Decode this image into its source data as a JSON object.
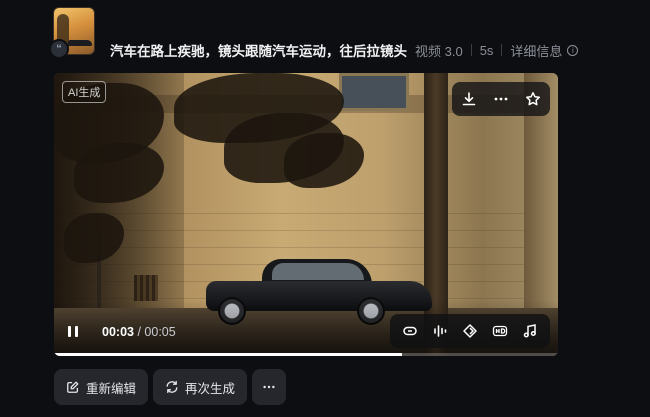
{
  "header": {
    "prompt": "汽车在路上疾驰，镜头跟随汽车运动，往后拉镜头",
    "model": "视频 3.0",
    "duration": "5s",
    "details_label": "详细信息",
    "avatar_badge": "“"
  },
  "player": {
    "ai_tag": "AI生成",
    "current_time": "00:03",
    "total_time": "/ 00:05",
    "progress": 0.69,
    "top_tools": [
      "download-icon",
      "more-icon",
      "star-icon"
    ],
    "bottom_tools": [
      "loop-icon",
      "audio-wave-icon",
      "diamond-icon",
      "hd-icon",
      "music-note-icon"
    ]
  },
  "actions": {
    "reedit_label": "重新编辑",
    "regenerate_label": "再次生成"
  },
  "colors": {
    "background": "#0d0e11",
    "button_bg": "#25272d",
    "muted_text": "#8b8f98"
  }
}
